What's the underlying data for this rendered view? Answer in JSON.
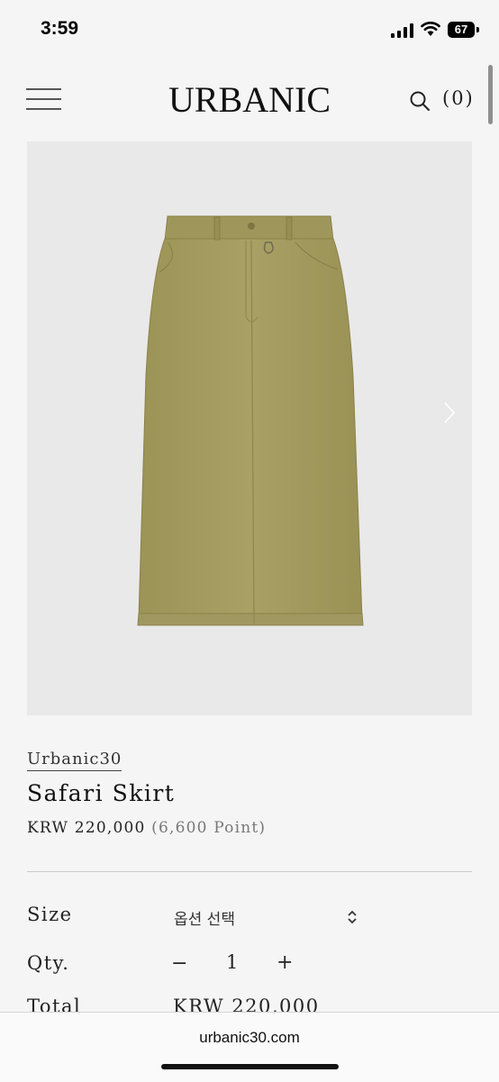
{
  "status_bar": {
    "time": "3:59",
    "battery": "67",
    "icons": [
      "cellular-signal-icon",
      "wifi-icon",
      "battery-icon"
    ]
  },
  "header": {
    "logo": "URBANIC",
    "cart_count": "(0)",
    "icons": [
      "menu-icon",
      "search-icon"
    ]
  },
  "product": {
    "image_icon": "skirt-illustration",
    "skirt_color": "#a39a5f",
    "brand": "Urbanic30",
    "name": "Safari Skirt",
    "price": "KRW 220,000",
    "points": "(6,600 Point)"
  },
  "options": {
    "size_label": "Size",
    "size_value": "옵션 선택",
    "qty_label": "Qty.",
    "qty_minus": "−",
    "qty_value": "1",
    "qty_plus": "+",
    "total_label": "Total",
    "total_value": "KRW 220,000"
  },
  "browser": {
    "url": "urbanic30.com"
  }
}
